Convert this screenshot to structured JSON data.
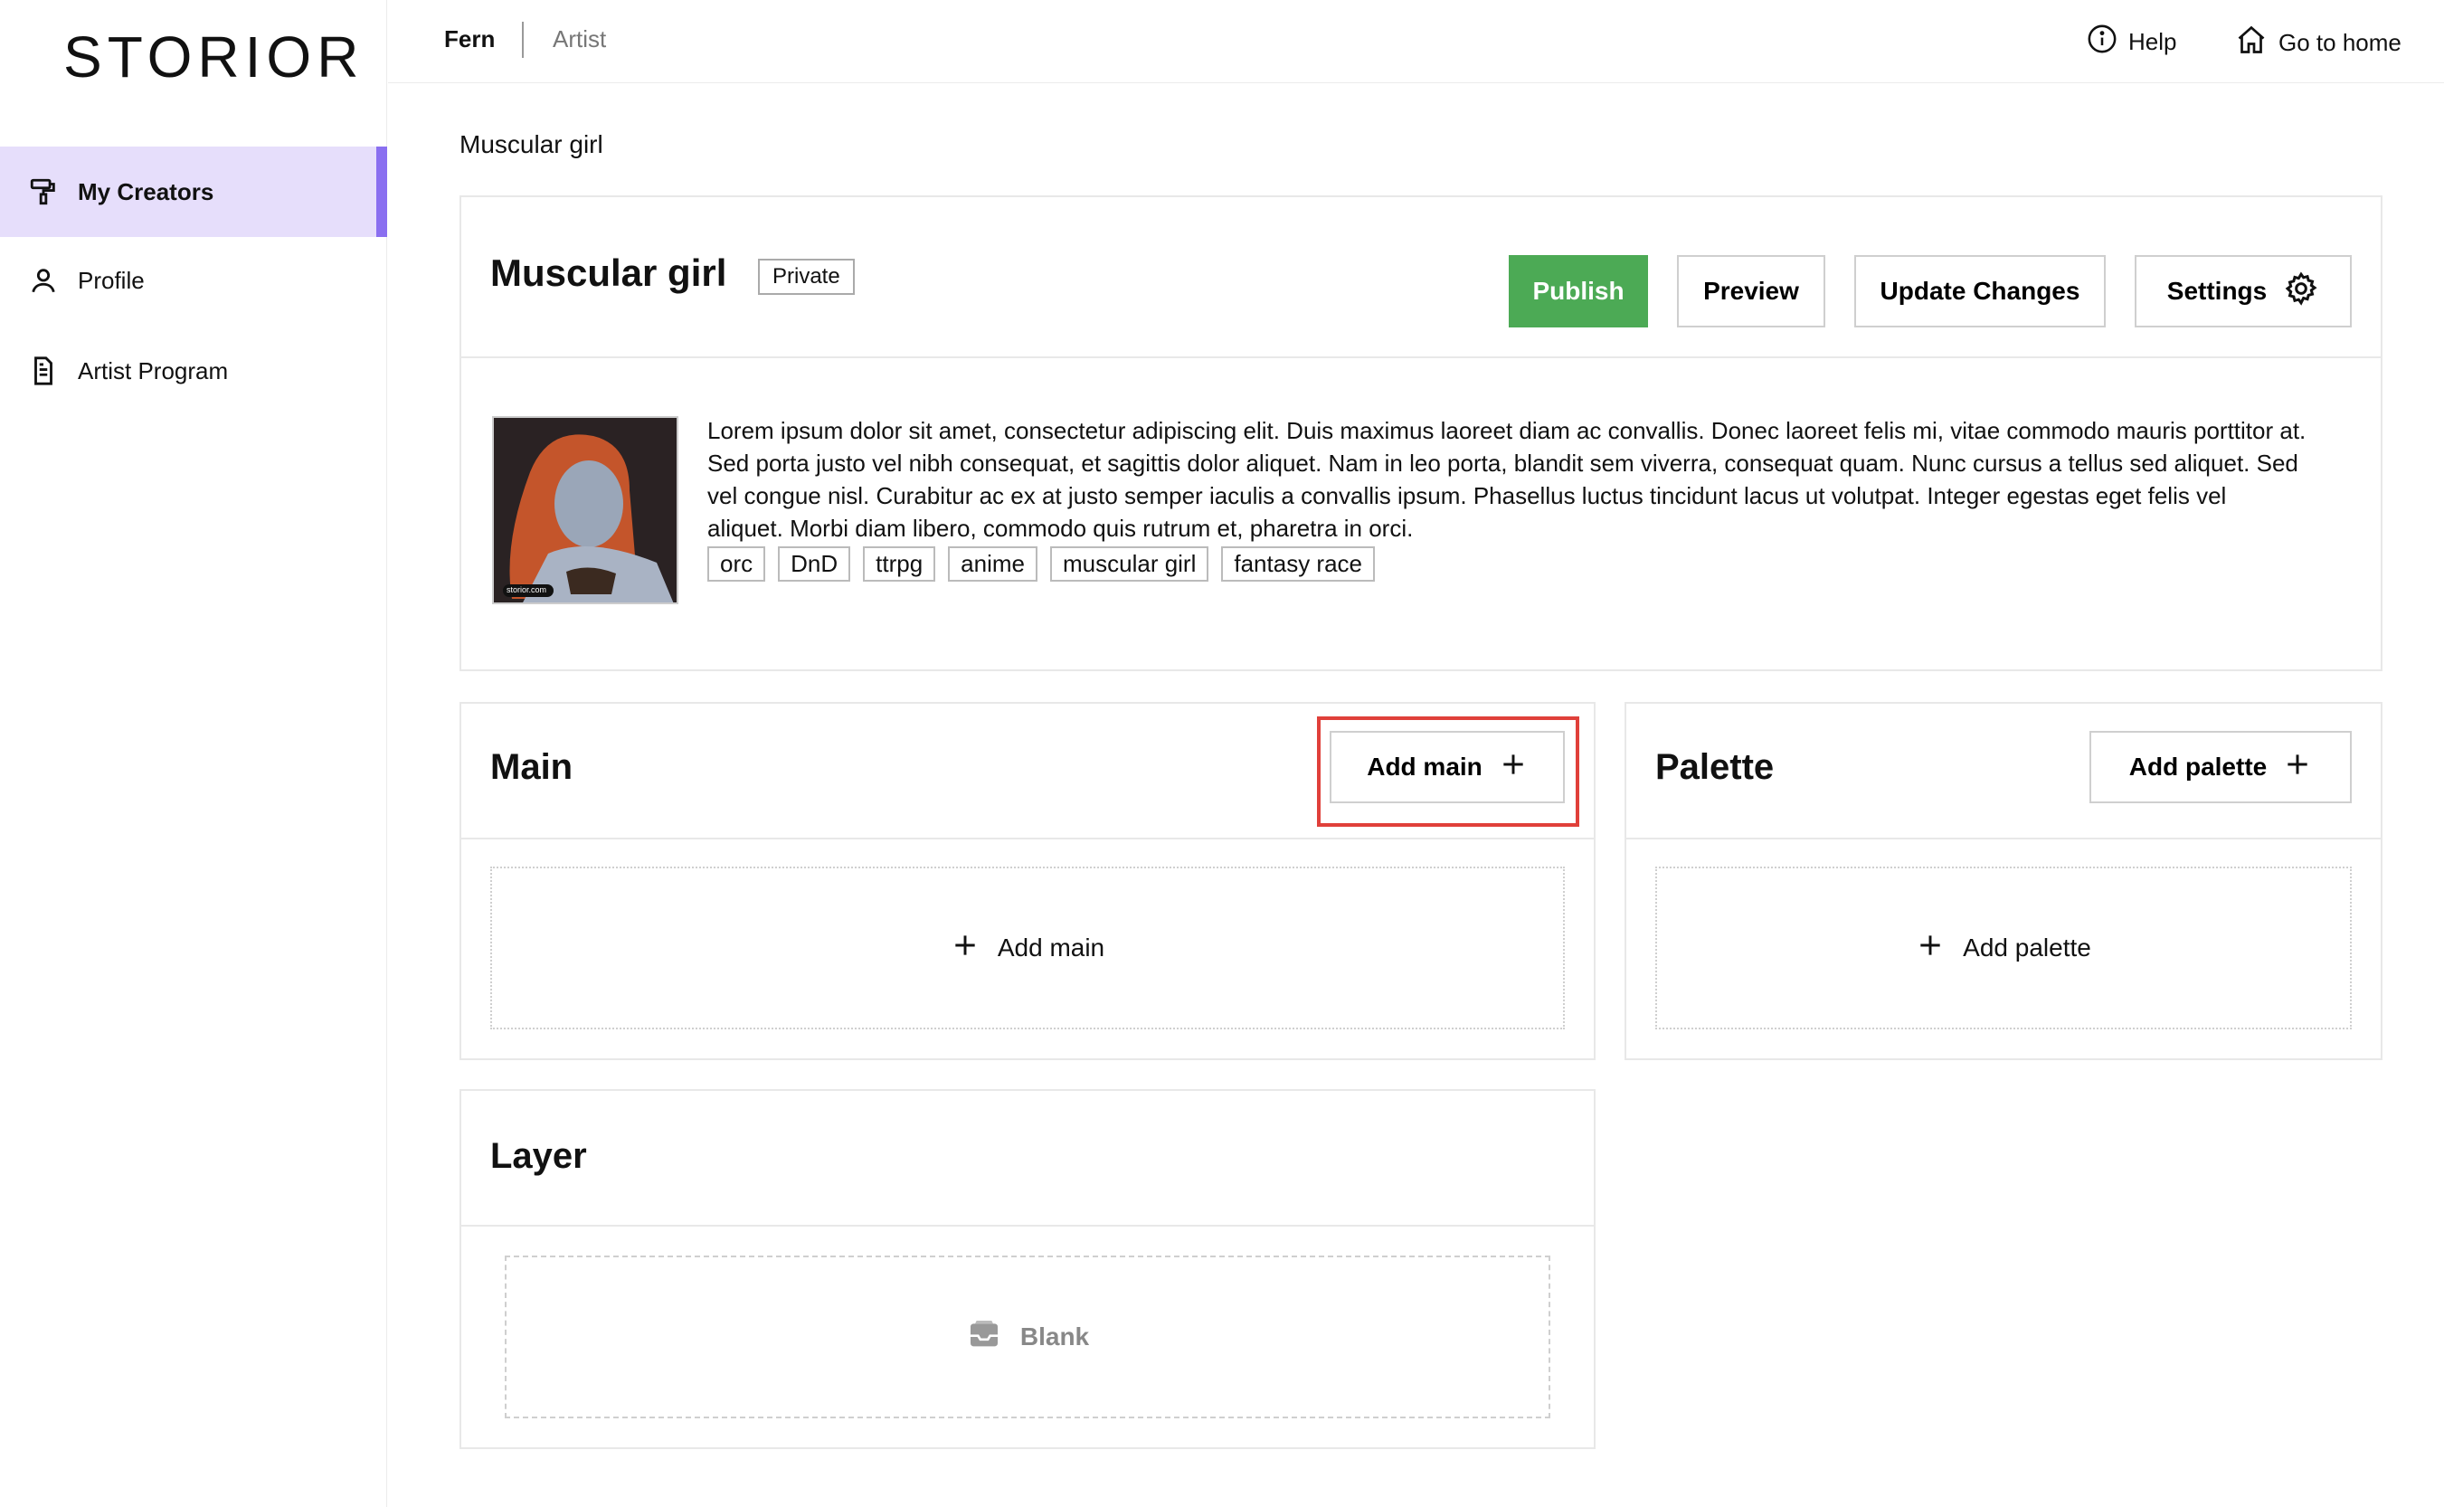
{
  "brand": {
    "logo_text": "STORIOR"
  },
  "sidebar": {
    "items": [
      {
        "label": "My Creators",
        "icon": "paint-roller-icon",
        "active": true
      },
      {
        "label": "Profile",
        "icon": "user-icon",
        "active": false
      },
      {
        "label": "Artist Program",
        "icon": "document-icon",
        "active": false
      }
    ]
  },
  "header": {
    "user": "Fern",
    "role": "Artist",
    "help_label": "Help",
    "home_label": "Go to home"
  },
  "page": {
    "title": "Muscular girl"
  },
  "creator": {
    "name": "Muscular girl",
    "visibility": "Private",
    "description": "Lorem ipsum dolor sit amet, consectetur adipiscing elit. Duis maximus laoreet diam ac convallis. Donec laoreet felis mi, vitae commodo mauris porttitor at. Sed porta justo vel nibh consequat, et sagittis dolor aliquet. Nam in leo porta, blandit sem viverra, consequat quam. Nunc cursus a tellus sed aliquet. Sed vel congue nisl. Curabitur ac ex at justo semper iaculis a convallis ipsum. Phasellus luctus tincidunt lacus ut volutpat. Integer egestas eget felis vel aliquet. Morbi diam libero, commodo quis rutrum et, pharetra in orci.",
    "tags": [
      "orc",
      "DnD",
      "ttrpg",
      "anime",
      "muscular girl",
      "fantasy race"
    ],
    "thumb_watermark": "storior.com"
  },
  "toolbar": {
    "publish": "Publish",
    "preview": "Preview",
    "update": "Update Changes",
    "settings": "Settings"
  },
  "main_section": {
    "title": "Main",
    "add_button": "Add main",
    "add_area": "Add main"
  },
  "palette_section": {
    "title": "Palette",
    "add_button": "Add palette",
    "add_area": "Add palette"
  },
  "layer_section": {
    "title": "Layer",
    "empty_label": "Blank"
  },
  "colors": {
    "accent": "#8a6ff0",
    "active_bg": "#e6defb",
    "publish": "#4caa55",
    "highlight": "#e0403a"
  }
}
